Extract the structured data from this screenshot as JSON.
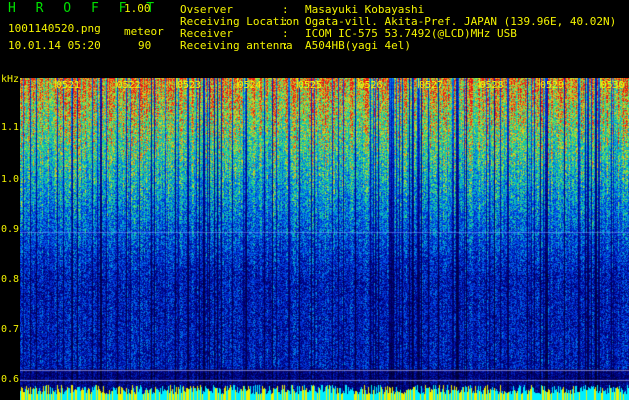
{
  "header": {
    "brand": "H R O F F T",
    "version": "1.00",
    "filename": "1001140520.png",
    "mode": "meteor",
    "datetime": "10.01.14 05:20",
    "count": "90",
    "info": [
      {
        "label": "Ovserver",
        "value": "Masayuki Kobayashi"
      },
      {
        "label": "Receiving Location",
        "value": "Ogata-vill. Akita-Pref. JAPAN (139.96E, 40.02N)"
      },
      {
        "label": "Receiver",
        "value": "ICOM IC-575 53.7492(@LCD)MHz USB"
      },
      {
        "label": "Receiving antenna",
        "value": "A504HB(yagi 4el)"
      }
    ],
    "colon": ":"
  },
  "axis": {
    "y_unit": "kHz",
    "y_ticks": [
      "1.1",
      "1.0",
      "0.9",
      "0.8",
      "0.7",
      "0.6"
    ],
    "x_ticks": [
      "0521",
      "0522",
      "0523",
      "0524",
      "0525",
      "0526",
      "0527",
      "0528",
      "0529",
      "0530"
    ]
  },
  "colors": {
    "text": "#f4f400",
    "brand": "#00e000",
    "background": "#000000",
    "meteor_trace": "#00ffff"
  }
}
